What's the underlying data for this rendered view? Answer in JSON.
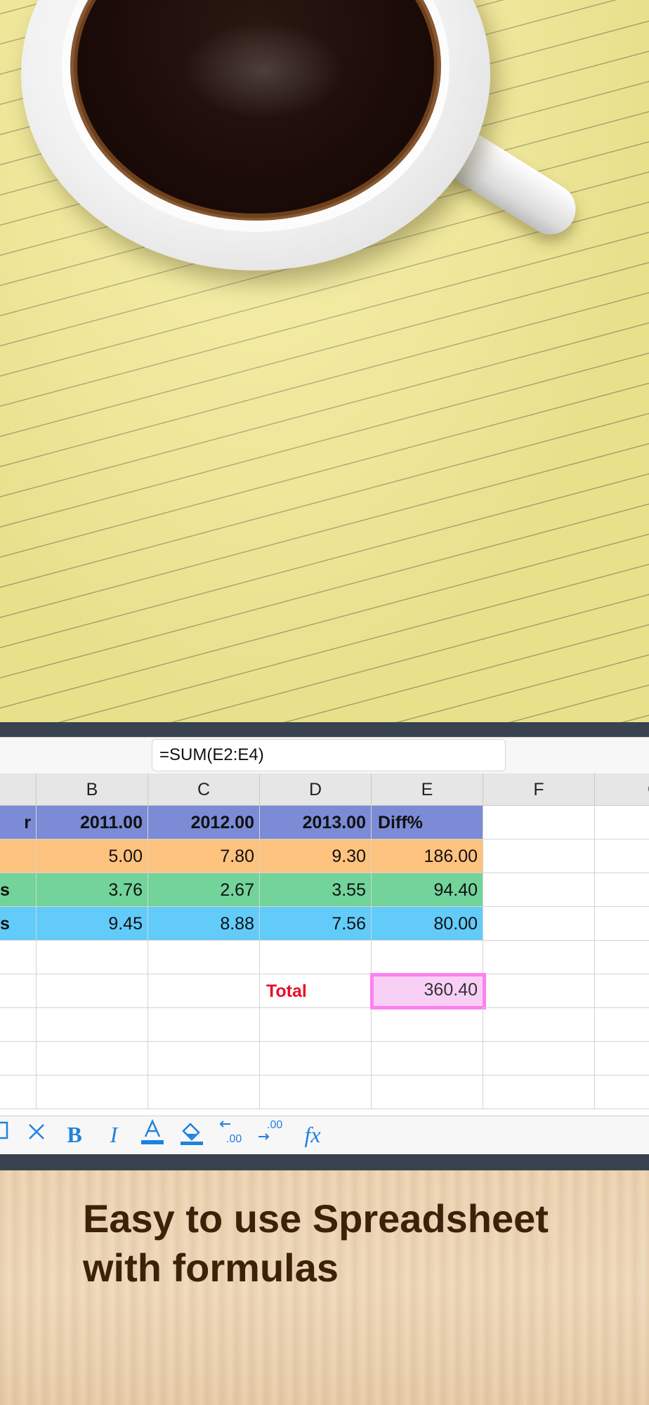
{
  "formula_bar": {
    "value": "=SUM(E2:E4)"
  },
  "columns": [
    "B",
    "C",
    "D",
    "E",
    "F",
    "G"
  ],
  "rows": [
    {
      "a": "r",
      "b": "2011.00",
      "c": "2012.00",
      "d": "2013.00",
      "e": "Diff%",
      "style": "header"
    },
    {
      "a": "",
      "b": "5.00",
      "c": "7.80",
      "d": "9.30",
      "e": "186.00",
      "style": "orange"
    },
    {
      "a": "s",
      "b": "3.76",
      "c": "2.67",
      "d": "3.55",
      "e": "94.40",
      "style": "green"
    },
    {
      "a": "s",
      "b": "9.45",
      "c": "8.88",
      "d": "7.56",
      "e": "80.00",
      "style": "blue"
    }
  ],
  "total": {
    "label": "Total",
    "value": "360.40"
  },
  "toolbar": {
    "items": [
      {
        "name": "copy-icon",
        "glyph": "▯"
      },
      {
        "name": "clear-icon",
        "glyph": "✕"
      },
      {
        "name": "bold-icon",
        "glyph": "B"
      },
      {
        "name": "italic-icon",
        "glyph": "I"
      },
      {
        "name": "text-color-icon",
        "glyph": "A"
      },
      {
        "name": "fill-color-icon",
        "glyph": "⬙"
      },
      {
        "name": "decrease-decimal-icon",
        "glyph": "←.00"
      },
      {
        "name": "increase-decimal-icon",
        "glyph": "→.00"
      },
      {
        "name": "function-icon",
        "glyph": "fx"
      }
    ]
  },
  "caption": {
    "line1": "Easy to use Spreadsheet",
    "line2": "with formulas"
  },
  "colors": {
    "header": "#7b8bd6",
    "orange": "#fec27f",
    "green": "#72d49a",
    "blue": "#63cbf9",
    "total": "#e8102b",
    "selection": "#ff80f0",
    "accent": "#1e82e0"
  }
}
